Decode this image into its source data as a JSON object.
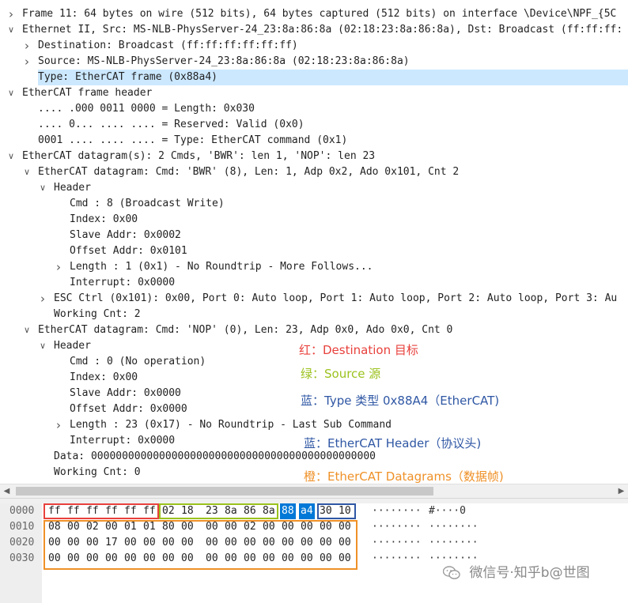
{
  "tree_rows": [
    {
      "indent": 0,
      "arrow": "right",
      "text": "Frame 11: 64 bytes on wire (512 bits), 64 bytes captured (512 bits) on interface \\Device\\NPF_{5C"
    },
    {
      "indent": 0,
      "arrow": "down",
      "text": "Ethernet II, Src: MS-NLB-PhysServer-24_23:8a:86:8a (02:18:23:8a:86:8a), Dst: Broadcast (ff:ff:ff:"
    },
    {
      "indent": 1,
      "arrow": "right",
      "text": "Destination: Broadcast (ff:ff:ff:ff:ff:ff)"
    },
    {
      "indent": 1,
      "arrow": "right",
      "text": "Source: MS-NLB-PhysServer-24_23:8a:86:8a (02:18:23:8a:86:8a)"
    },
    {
      "indent": 1,
      "arrow": "",
      "text": "Type: EtherCAT frame (0x88a4)",
      "selected": true
    },
    {
      "indent": 0,
      "arrow": "down",
      "text": "EtherCAT frame header"
    },
    {
      "indent": 1,
      "arrow": "",
      "text": ".... .000 0011 0000 = Length: 0x030"
    },
    {
      "indent": 1,
      "arrow": "",
      "text": ".... 0... .... .... = Reserved: Valid (0x0)"
    },
    {
      "indent": 1,
      "arrow": "",
      "text": "0001 .... .... .... = Type: EtherCAT command (0x1)"
    },
    {
      "indent": 0,
      "arrow": "down",
      "text": "EtherCAT datagram(s): 2 Cmds, 'BWR': len 1, 'NOP': len 23"
    },
    {
      "indent": 1,
      "arrow": "down",
      "text": "EtherCAT datagram: Cmd: 'BWR' (8), Len: 1, Adp 0x2, Ado 0x101, Cnt 2"
    },
    {
      "indent": 2,
      "arrow": "down",
      "text": "Header"
    },
    {
      "indent": 3,
      "arrow": "",
      "text": "Cmd       : 8 (Broadcast Write)"
    },
    {
      "indent": 3,
      "arrow": "",
      "text": "Index: 0x00"
    },
    {
      "indent": 3,
      "arrow": "",
      "text": "Slave Addr: 0x0002"
    },
    {
      "indent": 3,
      "arrow": "",
      "text": "Offset Addr: 0x0101"
    },
    {
      "indent": 3,
      "arrow": "right",
      "text": "Length     : 1 (0x1) - No Roundtrip - More Follows..."
    },
    {
      "indent": 3,
      "arrow": "",
      "text": "Interrupt: 0x0000"
    },
    {
      "indent": 2,
      "arrow": "right",
      "text": "ESC Ctrl (0x101): 0x00, Port 0: Auto loop, Port 1: Auto loop, Port 2: Auto loop, Port 3: Au"
    },
    {
      "indent": 2,
      "arrow": "",
      "text": "Working Cnt: 2"
    },
    {
      "indent": 1,
      "arrow": "down",
      "text": "EtherCAT datagram: Cmd: 'NOP' (0), Len: 23, Adp 0x0, Ado 0x0, Cnt 0"
    },
    {
      "indent": 2,
      "arrow": "down",
      "text": "Header"
    },
    {
      "indent": 3,
      "arrow": "",
      "text": "Cmd       : 0 (No operation)"
    },
    {
      "indent": 3,
      "arrow": "",
      "text": "Index: 0x00"
    },
    {
      "indent": 3,
      "arrow": "",
      "text": "Slave Addr: 0x0000"
    },
    {
      "indent": 3,
      "arrow": "",
      "text": "Offset Addr: 0x0000"
    },
    {
      "indent": 3,
      "arrow": "right",
      "text": "Length     : 23 (0x17) - No Roundtrip - Last Sub Command"
    },
    {
      "indent": 3,
      "arrow": "",
      "text": "Interrupt: 0x0000"
    },
    {
      "indent": 2,
      "arrow": "",
      "text": "Data: 0000000000000000000000000000000000000000000000"
    },
    {
      "indent": 2,
      "arrow": "",
      "text": "Working Cnt: 0"
    }
  ],
  "annotations": [
    {
      "text": "红：Destination  目标",
      "color": "#e8413c"
    },
    {
      "text": "绿：Source 源",
      "color": "#9bc21d"
    },
    {
      "text": "蓝：Type 类型 0x88A4（EtherCAT)",
      "color": "#2f57a4"
    },
    {
      "text": "蓝：EtherCAT Header（协议头)",
      "color": "#2f57a4"
    },
    {
      "text": "橙：EtherCAT Datagrams（数据帧)",
      "color": "#ef9128"
    }
  ],
  "hex_offsets": [
    "0000",
    "0010",
    "0020",
    "0030"
  ],
  "hex_rows": [
    [
      "ff",
      "ff",
      "ff",
      "ff",
      "ff",
      "ff",
      "02",
      "18",
      "23",
      "8a",
      "86",
      "8a",
      "88",
      "a4",
      "30",
      "10"
    ],
    [
      "08",
      "00",
      "02",
      "00",
      "01",
      "01",
      "80",
      "00",
      "00",
      "00",
      "02",
      "00",
      "00",
      "00",
      "00",
      "00"
    ],
    [
      "00",
      "00",
      "00",
      "17",
      "00",
      "00",
      "00",
      "00",
      "00",
      "00",
      "00",
      "00",
      "00",
      "00",
      "00",
      "00"
    ],
    [
      "00",
      "00",
      "00",
      "00",
      "00",
      "00",
      "00",
      "00",
      "00",
      "00",
      "00",
      "00",
      "00",
      "00",
      "00",
      "00"
    ]
  ],
  "ascii_rows": [
    [
      "········",
      "#····0"
    ],
    [
      "········",
      "········"
    ],
    [
      "········",
      "········"
    ],
    [
      "········",
      "········"
    ]
  ],
  "colors": {
    "red": "#e8413c",
    "green": "#9bc21d",
    "blue": "#2f57a4",
    "orange": "#ef9128",
    "selection": "#cce8ff",
    "byte_highlight": "#0078d7"
  },
  "watermark": {
    "text": "微信号·知乎b@世图",
    "icon": "wechat-logo-icon"
  },
  "scrollbar": {
    "left_arrow": "◀",
    "right_arrow": "▶"
  }
}
